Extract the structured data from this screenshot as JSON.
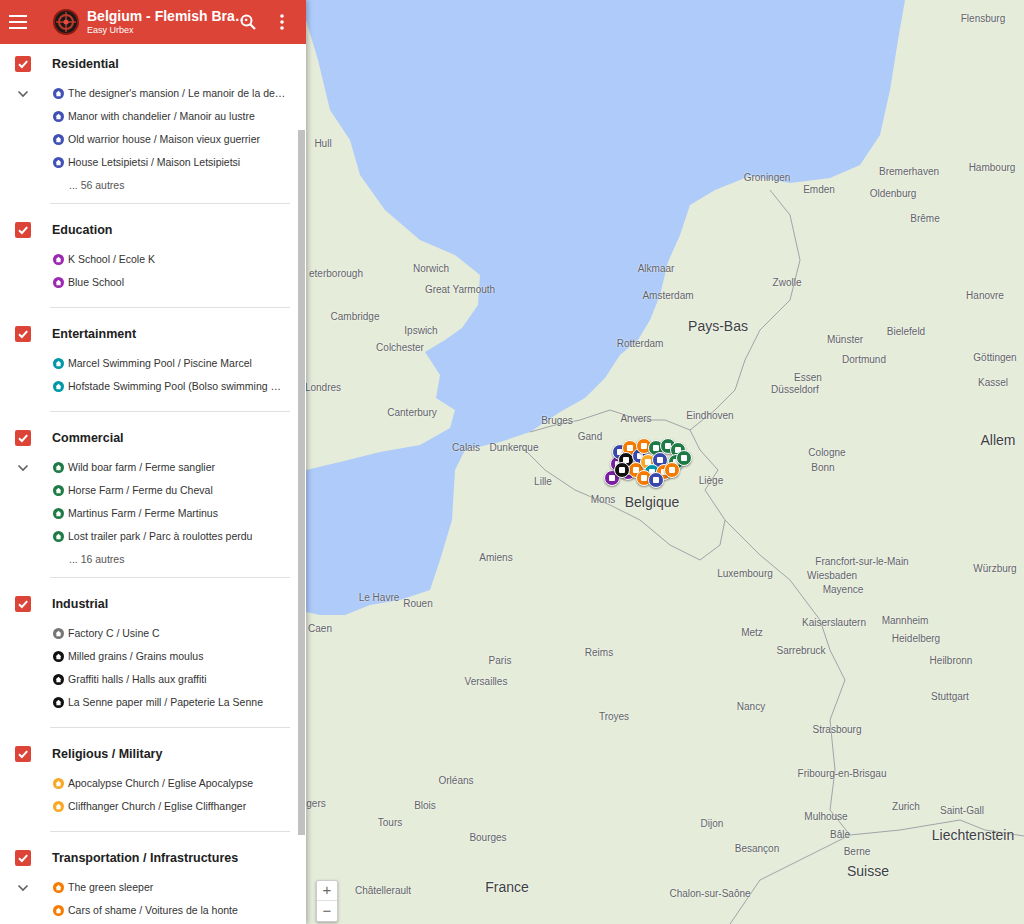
{
  "header": {
    "title": "Belgium - Flemish Bra…",
    "subtitle": "Easy Urbex"
  },
  "layers": [
    {
      "title": "Residential",
      "checked": true,
      "expander": true,
      "more": "... 56 autres",
      "items": [
        {
          "label": "The designer's mansion / Le manoir de la de…",
          "color": "#3f51b5"
        },
        {
          "label": "Manor with chandelier / Manoir au lustre",
          "color": "#3f51b5"
        },
        {
          "label": "Old warrior house / Maison vieux guerrier",
          "color": "#3f51b5"
        },
        {
          "label": "House Letsipietsi / Maison Letsipietsi",
          "color": "#3f51b5"
        }
      ]
    },
    {
      "title": "Education",
      "checked": true,
      "expander": false,
      "items": [
        {
          "label": "K School / Ecole K",
          "color": "#9c27b0"
        },
        {
          "label": "Blue School",
          "color": "#9c27b0"
        }
      ]
    },
    {
      "title": "Entertainment",
      "checked": true,
      "expander": false,
      "items": [
        {
          "label": "Marcel Swimming Pool / Piscine Marcel",
          "color": "#0097a7"
        },
        {
          "label": "Hofstade Swimming Pool (Bolso swimming …",
          "color": "#0097a7"
        }
      ]
    },
    {
      "title": "Commercial",
      "checked": true,
      "expander": true,
      "more": "... 16 autres",
      "items": [
        {
          "label": "Wild boar farm / Ferme sanglier",
          "color": "#1e7b45"
        },
        {
          "label": "Horse Farm / Ferme du Cheval",
          "color": "#1e7b45"
        },
        {
          "label": "Martinus Farm / Ferme Martinus",
          "color": "#1e7b45"
        },
        {
          "label": "Lost trailer park / Parc à roulottes perdu",
          "color": "#1e7b45"
        }
      ]
    },
    {
      "title": "Industrial",
      "checked": true,
      "expander": false,
      "items": [
        {
          "label": "Factory C / Usine C",
          "color": "#757575"
        },
        {
          "label": "Milled grains / Grains moulus",
          "color": "#111111"
        },
        {
          "label": "Graffiti halls / Halls aux graffiti",
          "color": "#111111"
        },
        {
          "label": "La Senne paper mill / Papeterie La Senne",
          "color": "#111111"
        }
      ]
    },
    {
      "title": "Religious / Military",
      "checked": true,
      "expander": false,
      "items": [
        {
          "label": "Apocalypse Church / Eglise Apocalypse",
          "color": "#f9a825"
        },
        {
          "label": "Cliffhanger Church / Eglise Cliffhanger",
          "color": "#f9a825"
        }
      ]
    },
    {
      "title": "Transportation / Infrastructures",
      "checked": true,
      "expander": true,
      "items": [
        {
          "label": "The green sleeper",
          "color": "#f57c00"
        },
        {
          "label": "Cars of shame / Voitures de la honte",
          "color": "#f57c00"
        }
      ]
    }
  ],
  "map": {
    "labels": [
      {
        "text": "Flensburg",
        "kind": "city"
      },
      {
        "text": "Hull",
        "kind": "city"
      },
      {
        "text": "Hambourg",
        "kind": "city"
      },
      {
        "text": "Bremerhaven",
        "kind": "city"
      },
      {
        "text": "Groningen",
        "kind": "city"
      },
      {
        "text": "Emden",
        "kind": "city"
      },
      {
        "text": "Oldenburg",
        "kind": "city"
      },
      {
        "text": "Brême",
        "kind": "city"
      },
      {
        "text": "Norwich",
        "kind": "city"
      },
      {
        "text": "Great Yarmouth",
        "kind": "city"
      },
      {
        "text": "eterborough",
        "kind": "city"
      },
      {
        "text": "Alkmaar",
        "kind": "city"
      },
      {
        "text": "Zwolle",
        "kind": "city"
      },
      {
        "text": "Amsterdam",
        "kind": "city"
      },
      {
        "text": "Hanovre",
        "kind": "city"
      },
      {
        "text": "Cambridge",
        "kind": "city"
      },
      {
        "text": "Pays-Bas",
        "kind": "country"
      },
      {
        "text": "Ipswich",
        "kind": "city"
      },
      {
        "text": "Bielefeld",
        "kind": "city"
      },
      {
        "text": "Münster",
        "kind": "city"
      },
      {
        "text": "Rotterdam",
        "kind": "city"
      },
      {
        "text": "Colchester",
        "kind": "city"
      },
      {
        "text": "Göttingen",
        "kind": "city"
      },
      {
        "text": "Dortmund",
        "kind": "city"
      },
      {
        "text": "Essen",
        "kind": "city"
      },
      {
        "text": "Kassel",
        "kind": "city"
      },
      {
        "text": "Londres",
        "kind": "city"
      },
      {
        "text": "Düsseldorf",
        "kind": "city"
      },
      {
        "text": "Canterbury",
        "kind": "city"
      },
      {
        "text": "Eindhoven",
        "kind": "city"
      },
      {
        "text": "Anvers",
        "kind": "city"
      },
      {
        "text": "Bruges",
        "kind": "city"
      },
      {
        "text": "Gand",
        "kind": "city"
      },
      {
        "text": "Allem",
        "kind": "country"
      },
      {
        "text": "Dunkerque",
        "kind": "city"
      },
      {
        "text": "Calais",
        "kind": "city"
      },
      {
        "text": "Cologne",
        "kind": "city"
      },
      {
        "text": "Bonn",
        "kind": "city"
      },
      {
        "text": "Lille",
        "kind": "city"
      },
      {
        "text": "Liège",
        "kind": "city"
      },
      {
        "text": "Mons",
        "kind": "city"
      },
      {
        "text": "Belgique",
        "kind": "country"
      },
      {
        "text": "Amiens",
        "kind": "city"
      },
      {
        "text": "Luxembourg",
        "kind": "city"
      },
      {
        "text": "Francfort-sur-le-Main",
        "kind": "city"
      },
      {
        "text": "Wiesbaden",
        "kind": "city"
      },
      {
        "text": "Mayence",
        "kind": "city"
      },
      {
        "text": "Würzburg",
        "kind": "city"
      },
      {
        "text": "Le Havre",
        "kind": "city"
      },
      {
        "text": "Rouen",
        "kind": "city"
      },
      {
        "text": "Mannheim",
        "kind": "city"
      },
      {
        "text": "Kaiserslautern",
        "kind": "city"
      },
      {
        "text": "Caen",
        "kind": "city"
      },
      {
        "text": "Metz",
        "kind": "city"
      },
      {
        "text": "Heidelberg",
        "kind": "city"
      },
      {
        "text": "Sarrebruck",
        "kind": "city"
      },
      {
        "text": "Reims",
        "kind": "city"
      },
      {
        "text": "Paris",
        "kind": "city"
      },
      {
        "text": "Heilbronn",
        "kind": "city"
      },
      {
        "text": "Versailles",
        "kind": "city"
      },
      {
        "text": "Stuttgart",
        "kind": "city"
      },
      {
        "text": "Nancy",
        "kind": "city"
      },
      {
        "text": "Troyes",
        "kind": "city"
      },
      {
        "text": "Strasbourg",
        "kind": "city"
      },
      {
        "text": "Fribourg-en-Brisgau",
        "kind": "city"
      },
      {
        "text": "Orléans",
        "kind": "city"
      },
      {
        "text": "gers",
        "kind": "city"
      },
      {
        "text": "Blois",
        "kind": "city"
      },
      {
        "text": "Mulhouse",
        "kind": "city"
      },
      {
        "text": "Tours",
        "kind": "city"
      },
      {
        "text": "Dijon",
        "kind": "city"
      },
      {
        "text": "Saint-Gall",
        "kind": "city"
      },
      {
        "text": "Zurich",
        "kind": "city"
      },
      {
        "text": "Bâle",
        "kind": "city"
      },
      {
        "text": "Liechtenstein",
        "kind": "country"
      },
      {
        "text": "Bourges",
        "kind": "city"
      },
      {
        "text": "Besançon",
        "kind": "city"
      },
      {
        "text": "Suisse",
        "kind": "country"
      },
      {
        "text": "Berne",
        "kind": "city"
      },
      {
        "text": "Châtellerault",
        "kind": "city"
      },
      {
        "text": "France",
        "kind": "country"
      },
      {
        "text": "Chalon-sur-Saône",
        "kind": "city"
      }
    ],
    "markers": [
      {
        "color": "#7b1fa2"
      },
      {
        "color": "#7b1fa2"
      },
      {
        "color": "#7b1fa2"
      },
      {
        "color": "#3949ab"
      },
      {
        "color": "#f57c00"
      },
      {
        "color": "#111111"
      },
      {
        "color": "#3949ab"
      },
      {
        "color": "#f57c00"
      },
      {
        "color": "#1e7b45"
      },
      {
        "color": "#f57c00"
      },
      {
        "color": "#f9a825"
      },
      {
        "color": "#1e7b45"
      },
      {
        "color": "#1e7b45"
      },
      {
        "color": "#3949ab"
      },
      {
        "color": "#0097a7"
      },
      {
        "color": "#f57c00"
      },
      {
        "color": "#1e7b45"
      },
      {
        "color": "#111111"
      },
      {
        "color": "#f57c00"
      },
      {
        "color": "#1e7b45"
      },
      {
        "color": "#f57c00"
      },
      {
        "color": "#3949ab"
      }
    ],
    "zoom": {
      "in": "+",
      "out": "−"
    }
  }
}
